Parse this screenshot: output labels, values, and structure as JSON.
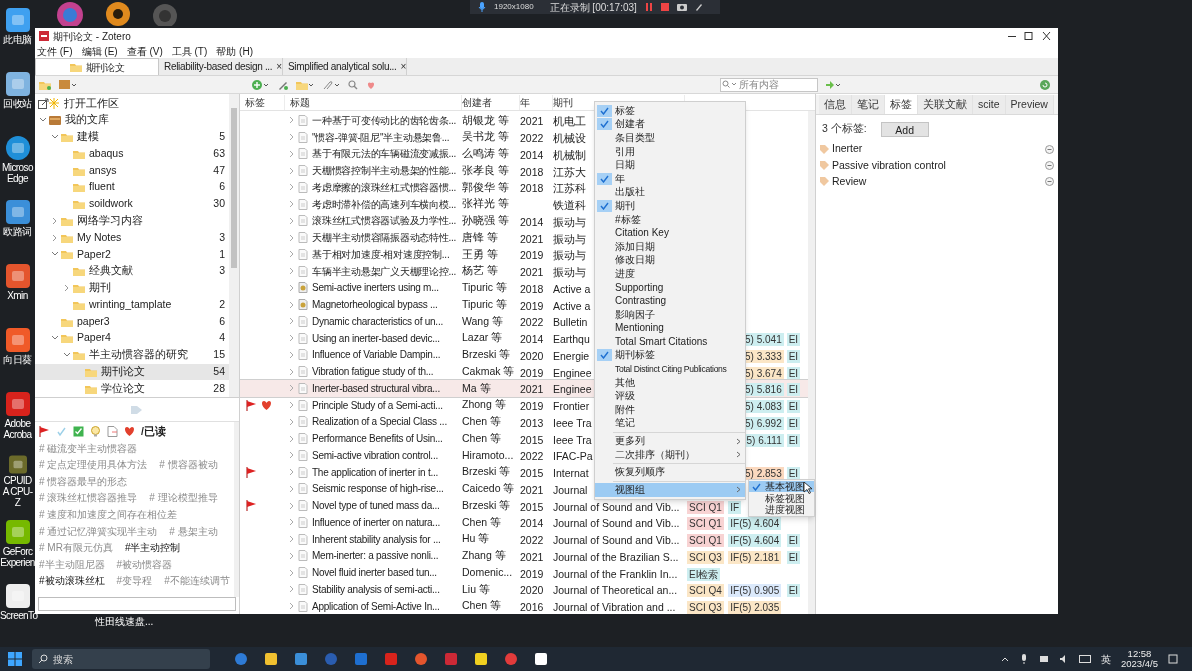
{
  "recording_bar": {
    "resolution": "1920x1080",
    "status": "正在录制 [00:17:03]"
  },
  "desktop_icons": [
    {
      "kind": "pc",
      "label": "此电脑"
    },
    {
      "kind": "bin",
      "label": "回收站"
    },
    {
      "kind": "edge",
      "label": "Microso Edge"
    },
    {
      "kind": "dict",
      "label": "欧路词"
    },
    {
      "kind": "xmind",
      "label": "Xmin"
    },
    {
      "kind": "sun",
      "label": "向日葵"
    },
    {
      "kind": "acrobat",
      "label": "Adobe Acroba"
    },
    {
      "kind": "cpuz",
      "label": "CPUID A CPU-Z"
    },
    {
      "kind": "geforce",
      "label": "GeForc Experien"
    },
    {
      "kind": "gif",
      "label": "ScreenTo"
    }
  ],
  "window": {
    "title": "期刊论文 - Zotero",
    "menu": [
      "文件 (F)",
      "编辑 (E)",
      "查看 (V)",
      "工具 (T)",
      "帮助 (H)"
    ],
    "tabs": [
      {
        "label": "期刊论文",
        "selected": true
      },
      {
        "label": "Reliability-based design ...",
        "selected": false,
        "close": "×"
      },
      {
        "label": "Simplified analytical solu...",
        "selected": false,
        "close": "×"
      }
    ],
    "search": {
      "placeholder": "所有内容"
    }
  },
  "workspace_link": "打开工作区",
  "collections": [
    {
      "label": "我的文库",
      "kind": "library",
      "expanded": true,
      "selected": false,
      "children": [
        {
          "label": "建模",
          "count": "5",
          "expanded": true,
          "selected": false,
          "children": [
            {
              "label": "abaqus",
              "count": "63",
              "selected": false
            },
            {
              "label": "ansys",
              "count": "47",
              "selected": false
            },
            {
              "label": "fluent",
              "count": "6",
              "selected": false
            },
            {
              "label": "soildwork",
              "count": "30",
              "selected": false
            }
          ]
        },
        {
          "label": "网络学习内容",
          "expanded": false,
          "selected": false,
          "has_children": true
        },
        {
          "label": "My Notes",
          "count": "3",
          "expanded": false,
          "selected": false,
          "has_children": true
        },
        {
          "label": "Paper2",
          "count": "1",
          "expanded": true,
          "selected": false,
          "children": [
            {
              "label": "经典文献",
              "count": "3",
              "selected": false
            },
            {
              "label": "期刊",
              "expanded": false,
              "selected": false,
              "has_children": true
            },
            {
              "label": "wrinting_tamplate",
              "count": "2",
              "selected": false
            }
          ]
        },
        {
          "label": "paper3",
          "count": "6",
          "selected": false
        },
        {
          "label": "Paper4",
          "count": "4",
          "expanded": true,
          "selected": false,
          "children": [
            {
              "label": "半主动惯容器的研究",
              "count": "15",
              "expanded": true,
              "selected": false,
              "children": [
                {
                  "label": "期刊论文",
                  "count": "54",
                  "selected": true
                },
                {
                  "label": "学位论文",
                  "count": "28",
                  "selected": false
                }
              ]
            }
          ]
        }
      ]
    }
  ],
  "tag_selector": {
    "colored_tags": [
      {
        "kind": "flag"
      },
      {
        "kind": "check"
      },
      {
        "kind": "checkbox"
      },
      {
        "kind": "bulb"
      },
      {
        "kind": "note"
      },
      {
        "kind": "heart"
      },
      {
        "kind": "text",
        "label": "/已读"
      }
    ],
    "tag_rows": [
      [
        {
          "label": "# 磁流变半主动惯容器",
          "highlighted": false
        }
      ],
      [
        {
          "label": "# 定点定理使用具体方法",
          "highlighted": false
        },
        {
          "label": "# 惯容器被动",
          "highlighted": false
        }
      ],
      [
        {
          "label": "# 惯容器最早的形态",
          "highlighted": false
        }
      ],
      [
        {
          "label": "# 滚珠丝杠惯容器推导",
          "highlighted": false
        },
        {
          "label": "# 理论模型推导",
          "highlighted": false
        }
      ],
      [
        {
          "label": "# 速度和加速度之间存在相位差",
          "highlighted": false
        }
      ],
      [
        {
          "label": "# 通过记忆弹簧实现半主动",
          "highlighted": false
        },
        {
          "label": "# 悬架主动",
          "highlighted": false
        }
      ],
      [
        {
          "label": "# MR有限元仿真",
          "highlighted": false
        },
        {
          "label": "#半主动控制",
          "highlighted": true
        }
      ],
      [
        {
          "label": "#半主动阻尼器",
          "highlighted": false
        },
        {
          "label": "#被动惯容器",
          "highlighted": false
        }
      ],
      [
        {
          "label": "#被动滚珠丝杠",
          "highlighted": true
        },
        {
          "label": "#变导程",
          "highlighted": false
        },
        {
          "label": "#不能连续调节",
          "highlighted": false
        }
      ]
    ]
  },
  "table": {
    "columns": [
      "标签",
      "标题",
      "创建者",
      "年",
      "期刊"
    ],
    "rows": [
      {
        "title": "一种基于可变传动比的齿轮齿条...",
        "creator": "胡银龙 等",
        "year": "2021",
        "journal": "机电工",
        "kind": "document",
        "selected": false,
        "flagged": false,
        "favorite": false
      },
      {
        "title": "\"惯容-弹簧-阻尼\"半主动悬架鲁...",
        "creator": "吴书龙 等",
        "year": "2022",
        "journal": "机械设",
        "kind": "document",
        "selected": false,
        "flagged": false,
        "favorite": false
      },
      {
        "title": "基于有限元法的车辆磁流变减振...",
        "creator": "么鸣涛 等",
        "year": "2014",
        "journal": "机械制",
        "kind": "document",
        "selected": false,
        "flagged": false,
        "favorite": false
      },
      {
        "title": "天棚惯容控制半主动悬架的性能...",
        "creator": "张孝良 等",
        "year": "2018",
        "journal": "江苏大",
        "kind": "document",
        "selected": false,
        "flagged": false,
        "favorite": false
      },
      {
        "title": "考虑摩擦的滚珠丝杠式惯容器惯...",
        "creator": "郭俊华 等",
        "year": "2018",
        "journal": "江苏科",
        "kind": "document",
        "selected": false,
        "flagged": false,
        "favorite": false
      },
      {
        "title": "考虑时滞补偿的高速列车横向模...",
        "creator": "张祥光 等",
        "journal": "铁道科",
        "kind": "document",
        "selected": false,
        "flagged": false,
        "favorite": false
      },
      {
        "title": "滚珠丝杠式惯容器试验及力学性...",
        "creator": "孙晓强 等",
        "year": "2014",
        "journal": "振动与",
        "kind": "document",
        "selected": false,
        "flagged": false,
        "favorite": false
      },
      {
        "title": "天棚半主动惯容隔振器动态特性...",
        "creator": "唐锋 等",
        "year": "2021",
        "journal": "振动与",
        "kind": "document",
        "selected": false,
        "flagged": false,
        "favorite": false
      },
      {
        "title": "基于相对加速度-相对速度控制...",
        "creator": "王勇 等",
        "year": "2019",
        "journal": "振动与",
        "kind": "document",
        "selected": false,
        "flagged": false,
        "favorite": false
      },
      {
        "title": "车辆半主动悬架广义天棚理论控...",
        "creator": "杨艺 等",
        "year": "2021",
        "journal": "振动与",
        "kind": "document",
        "selected": false,
        "flagged": false,
        "favorite": false
      },
      {
        "title": "Semi-active inerters using m...",
        "creator": "Tipuric 等",
        "year": "2018",
        "journal": "Active a",
        "kind": "preprint",
        "selected": false,
        "flagged": false,
        "favorite": false
      },
      {
        "title": "Magnetorheological bypass ...",
        "creator": "Tipuric 等",
        "year": "2019",
        "journal": "Active a",
        "kind": "preprint",
        "selected": false,
        "flagged": false,
        "favorite": false
      },
      {
        "title": "Dynamic characteristics of un...",
        "creator": "Wang 等",
        "year": "2022",
        "journal": "Bulletin",
        "kind": "document",
        "selected": false,
        "flagged": false,
        "favorite": false
      },
      {
        "title": "Using an inerter-based devic...",
        "creator": "Lazar 等",
        "year": "2014",
        "journal": "Earthqu",
        "kind": "document",
        "selected": false,
        "flagged": false,
        "favorite": false,
        "tags": [
          {
            "kind": "if_tail",
            "text": "5) 5.041",
            "color": "#cdeef0"
          },
          {
            "kind": "ei",
            "text": "EI",
            "color": "#cdeef0"
          }
        ]
      },
      {
        "title": "Influence of Variable Dampin...",
        "creator": "Brzeski 等",
        "year": "2020",
        "journal": "Energie",
        "kind": "document",
        "selected": false,
        "flagged": false,
        "favorite": false,
        "tags": [
          {
            "kind": "if_tail",
            "text": "5) 3.333",
            "color": "#fbe6c6"
          },
          {
            "kind": "ei",
            "text": "EI",
            "color": "#cdeef0"
          }
        ]
      },
      {
        "title": "Vibration fatigue study of th...",
        "creator": "Cakmak 等",
        "year": "2019",
        "journal": "Enginee",
        "kind": "document",
        "selected": false,
        "flagged": false,
        "favorite": false,
        "tags": [
          {
            "kind": "if_tail",
            "text": "5) 3.674",
            "color": "#fbe6c6"
          },
          {
            "kind": "ei",
            "text": "EI",
            "color": "#cdeef0"
          }
        ]
      },
      {
        "title": "Inerter-based structural vibra...",
        "creator": "Ma 等",
        "year": "2021",
        "journal": "Enginee",
        "kind": "document",
        "selected": true,
        "flagged": false,
        "favorite": false,
        "tags": [
          {
            "kind": "if_tail",
            "text": "5) 5.816",
            "color": "#cdeef0"
          },
          {
            "kind": "ei",
            "text": "EI",
            "color": "#cdeef0"
          }
        ]
      },
      {
        "title": "Principle Study of a Semi-acti...",
        "creator": "Zhong 等",
        "year": "2019",
        "journal": "Frontier",
        "kind": "document",
        "selected": false,
        "flagged": true,
        "favorite": true,
        "tags": [
          {
            "kind": "if_tail",
            "text": "5) 4.083",
            "color": "#cdeef0"
          },
          {
            "kind": "ei",
            "text": "EI",
            "color": "#cdeef0"
          }
        ]
      },
      {
        "title": "Realization of a Special Class ...",
        "creator": "Chen 等",
        "year": "2013",
        "journal": "Ieee Tra",
        "kind": "document",
        "selected": false,
        "flagged": false,
        "favorite": false,
        "tags": [
          {
            "kind": "if_tail",
            "text": "5) 6.992",
            "color": "#cdeef0"
          },
          {
            "kind": "ei",
            "text": "EI",
            "color": "#cdeef0"
          }
        ]
      },
      {
        "title": "Performance Benefits of Usin...",
        "creator": "Chen 等",
        "year": "2015",
        "journal": "Ieee Tra",
        "kind": "document",
        "selected": false,
        "flagged": false,
        "favorite": false,
        "tags": [
          {
            "kind": "if_tail",
            "text": "5) 6.111",
            "color": "#cdeef0"
          },
          {
            "kind": "ei",
            "text": "EI",
            "color": "#cdeef0"
          }
        ]
      },
      {
        "title": "Semi-active vibration control...",
        "creator": "Hiramoto...",
        "year": "2022",
        "journal": "IFAC-Pa",
        "kind": "document",
        "selected": false,
        "flagged": false,
        "favorite": false
      },
      {
        "title": "The application of inerter in t...",
        "creator": "Brzeski 等",
        "year": "2015",
        "journal": "Internat",
        "kind": "document",
        "selected": false,
        "flagged": true,
        "favorite": false,
        "tags": [
          {
            "kind": "if_tail",
            "text": "5) 2.853",
            "color": "#fbd9bf"
          },
          {
            "kind": "ei",
            "text": "EI",
            "color": "#cdeef0"
          }
        ]
      },
      {
        "title": "Seismic response of high-rise...",
        "creator": "Caicedo 等",
        "year": "2021",
        "journal": "Journal",
        "kind": "document",
        "selected": false,
        "flagged": false,
        "favorite": false
      },
      {
        "title": "Novel type of tuned mass da...",
        "creator": "Brzeski 等",
        "year": "2015",
        "journal": "Journal of Sound and Vib...",
        "kind": "document",
        "selected": false,
        "flagged": true,
        "favorite": false,
        "tags": [
          {
            "kind": "sci",
            "text": "SCI Q1",
            "color": "#f8d3d3"
          },
          {
            "kind": "if",
            "text": "IF",
            "color": "#cdeef0"
          }
        ]
      },
      {
        "title": "Influence of inerter on natura...",
        "creator": "Chen 等",
        "year": "2014",
        "journal": "Journal of Sound and Vib...",
        "kind": "document",
        "selected": false,
        "flagged": false,
        "favorite": false,
        "tags": [
          {
            "kind": "sci",
            "text": "SCI Q1",
            "color": "#f8d3d3"
          },
          {
            "kind": "if",
            "text": "IF(5) 4.604",
            "color": "#cdeef0"
          }
        ]
      },
      {
        "title": "Inherent stability analysis for ...",
        "creator": "Hu 等",
        "year": "2022",
        "journal": "Journal of Sound and Vib...",
        "kind": "document",
        "selected": false,
        "flagged": false,
        "favorite": false,
        "tags": [
          {
            "kind": "sci",
            "text": "SCI Q1",
            "color": "#f8d3d3"
          },
          {
            "kind": "if",
            "text": "IF(5) 4.604",
            "color": "#cdeef0"
          },
          {
            "kind": "ei",
            "text": "EI",
            "color": "#cdeef0"
          }
        ]
      },
      {
        "title": "Mem-inerter: a passive nonli...",
        "creator": "Zhang 等",
        "year": "2021",
        "journal": "Journal of the Brazilian S...",
        "kind": "document",
        "selected": false,
        "flagged": false,
        "favorite": false,
        "tags": [
          {
            "kind": "sci",
            "text": "SCI Q3",
            "color": "#fbe6c6"
          },
          {
            "kind": "if",
            "text": "IF(5) 2.181",
            "color": "#fbe6c6"
          },
          {
            "kind": "ei",
            "text": "EI",
            "color": "#cdeef0"
          }
        ]
      },
      {
        "title": "Novel fluid inerter based tun...",
        "creator": "Domenic...",
        "year": "2019",
        "journal": "Journal of the Franklin In...",
        "kind": "document",
        "selected": false,
        "flagged": false,
        "favorite": false,
        "tags": [
          {
            "kind": "sci",
            "text": "EI检索",
            "color": "#cdeef0"
          }
        ]
      },
      {
        "title": "Stability analysis of semi-acti...",
        "creator": "Liu 等",
        "year": "2020",
        "journal": "Journal of Theoretical an...",
        "kind": "document",
        "selected": false,
        "flagged": false,
        "favorite": false,
        "tags": [
          {
            "kind": "sci",
            "text": "SCI Q4",
            "color": "#fbe6c6"
          },
          {
            "kind": "if",
            "text": "IF(5) 0.905",
            "color": "#dbe9fb"
          },
          {
            "kind": "ei",
            "text": "EI",
            "color": "#cdeef0"
          }
        ]
      },
      {
        "title": "Application of Semi-Active In...",
        "creator": "Chen 等",
        "year": "2016",
        "journal": "Journal of Vibration and ...",
        "kind": "document",
        "selected": false,
        "flagged": false,
        "favorite": false,
        "tags": [
          {
            "kind": "sci",
            "text": "SCI Q3",
            "color": "#fbe6c6"
          },
          {
            "kind": "if",
            "text": "IF(5) 2.035",
            "color": "#fbe6c6"
          }
        ]
      }
    ]
  },
  "context_menu": {
    "items": [
      {
        "kind": "check",
        "label": "标签",
        "checked": true
      },
      {
        "kind": "check",
        "label": "创建者",
        "checked": true
      },
      {
        "kind": "check",
        "label": "条目类型",
        "checked": false
      },
      {
        "kind": "check",
        "label": "引用",
        "checked": false
      },
      {
        "kind": "check",
        "label": "日期",
        "checked": false
      },
      {
        "kind": "check",
        "label": "年",
        "checked": true
      },
      {
        "kind": "check",
        "label": "出版社",
        "checked": false
      },
      {
        "kind": "check",
        "label": "期刊",
        "checked": true
      },
      {
        "kind": "check",
        "label": "#标签",
        "checked": false
      },
      {
        "kind": "check",
        "label": "Citation Key",
        "checked": false
      },
      {
        "kind": "check",
        "label": "添加日期",
        "checked": false
      },
      {
        "kind": "check",
        "label": "修改日期",
        "checked": false
      },
      {
        "kind": "check",
        "label": "进度",
        "checked": false
      },
      {
        "kind": "check",
        "label": "Supporting",
        "checked": false
      },
      {
        "kind": "check",
        "label": "Contrasting",
        "checked": false
      },
      {
        "kind": "check",
        "label": "影响因子",
        "checked": false
      },
      {
        "kind": "check",
        "label": "Mentioning",
        "checked": false
      },
      {
        "kind": "check",
        "label": "Total Smart Citations",
        "checked": false
      },
      {
        "kind": "check",
        "label": "期刊标签",
        "checked": true
      },
      {
        "kind": "check",
        "label": "Total Distinct Citing Publications",
        "checked": false
      },
      {
        "kind": "check",
        "label": "其他",
        "checked": false
      },
      {
        "kind": "check",
        "label": "评级",
        "checked": false
      },
      {
        "kind": "check",
        "label": "附件",
        "checked": false
      },
      {
        "kind": "check",
        "label": "笔记",
        "checked": false
      },
      {
        "kind": "separator"
      },
      {
        "kind": "submenu",
        "label": "更多列",
        "highlighted": false
      },
      {
        "kind": "submenu",
        "label": "二次排序（期刊）",
        "highlighted": false
      },
      {
        "kind": "separator"
      },
      {
        "kind": "action",
        "label": "恢复列顺序"
      },
      {
        "kind": "separator"
      },
      {
        "kind": "submenu",
        "label": "视图组",
        "highlighted": true
      }
    ]
  },
  "submenu": {
    "items": [
      {
        "label": "基本视图",
        "checked": true,
        "highlighted": true
      },
      {
        "label": "标签视图",
        "checked": false,
        "highlighted": false
      },
      {
        "label": "进度视图",
        "checked": false,
        "highlighted": false
      }
    ]
  },
  "item_pane": {
    "tabs": [
      {
        "label": "信息",
        "selected": false
      },
      {
        "label": "笔记",
        "selected": false
      },
      {
        "label": "标签",
        "selected": true
      },
      {
        "label": "关联文献",
        "selected": false
      },
      {
        "label": "scite",
        "selected": false
      },
      {
        "label": "Preview",
        "selected": false
      }
    ],
    "tag_count": "3 个标签:",
    "add_button": "Add",
    "tags": [
      "Inerter",
      "Passive vibration control",
      "Review"
    ]
  },
  "below_window_text": "性田线速盘...",
  "taskbar": {
    "search": "搜索",
    "ime": "英",
    "time": "12:58",
    "date": "2023/4/5"
  }
}
